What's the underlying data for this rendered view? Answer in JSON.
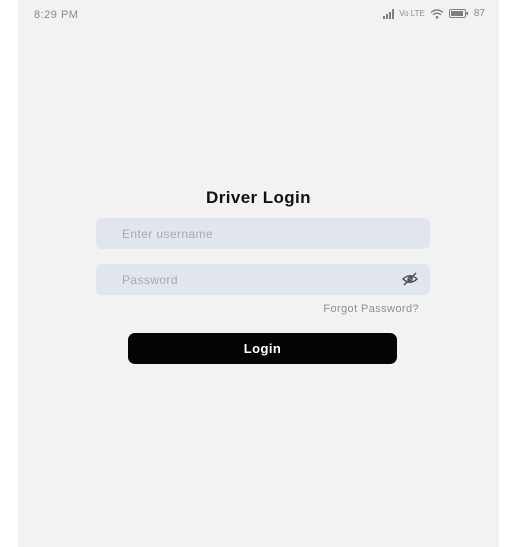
{
  "status_bar": {
    "time": "8:29 PM",
    "network": "Vo LTE",
    "battery": "87",
    "icons": [
      "signal-icon",
      "network-icon",
      "wifi-icon",
      "battery-icon"
    ]
  },
  "login": {
    "title": "Driver Login",
    "username_placeholder": "Enter username",
    "username_value": "",
    "password_placeholder": "Password",
    "password_value": "",
    "forgot_password": "Forgot Password?",
    "login_label": "Login"
  },
  "colors": {
    "background": "#f2f2f2",
    "field_bg": "#e1e5ee",
    "button_bg": "#050505",
    "button_text": "#ffffff"
  }
}
